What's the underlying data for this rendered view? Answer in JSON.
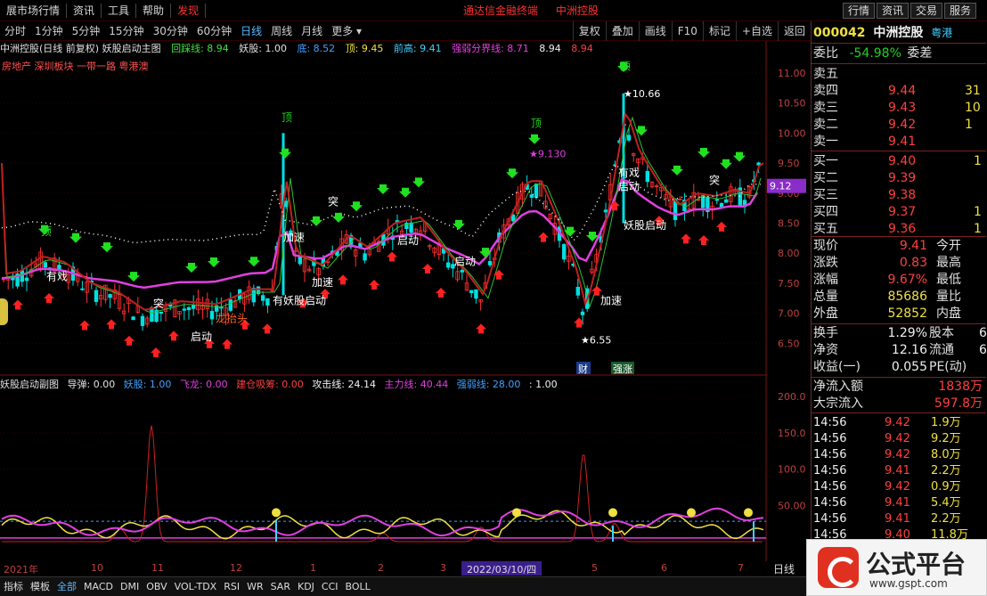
{
  "menu": {
    "items": [
      "展市场行情",
      "资讯",
      "工具",
      "帮助",
      "发现"
    ],
    "center": [
      "通达信金融终端",
      "中洲控股"
    ],
    "right_buttons": [
      "行情",
      "资讯",
      "交易",
      "服务"
    ]
  },
  "toolbar": {
    "periods": [
      "分时",
      "1分钟",
      "5分钟",
      "15分钟",
      "30分钟",
      "60分钟",
      "日线",
      "周线",
      "月线",
      "更多"
    ],
    "active_period": "日线",
    "right": [
      "复权",
      "叠加",
      "画线",
      "F10",
      "标记",
      "+自选",
      "返回"
    ]
  },
  "main_indicator": {
    "title": "中洲控股(日线 前复权) 妖股启动主图",
    "hui_cai": "回踩线: 8.94",
    "yao_gu": "妖股: 1.00",
    "di": "底: 8.52",
    "ding": "顶: 9.45",
    "qian_gao": "前高: 9.41",
    "strength": "强弱分界线: 8.71",
    "v1": "8.94",
    "v2": "8.94",
    "sector": "房地产 深圳板块 一带一路 粤港澳"
  },
  "sub_indicator": {
    "title": "妖股启动副图",
    "dao_dan": "导弹: 0.00",
    "yao_gu": "妖股: 1.00",
    "fei_long": "飞龙: 0.00",
    "jian_cang": "建仓吸筹: 0.00",
    "gong_ji": "攻击线: 24.14",
    "zhu_li": "主力线: 40.44",
    "qiang_ruo": "强弱线: 28.00",
    "last": ": 1.00"
  },
  "price_axis": [
    "11.00",
    "10.50",
    "10.00",
    "9.50",
    "9.00",
    "8.50",
    "8.00",
    "7.50",
    "7.00",
    "6.50"
  ],
  "current_price_tag": "9.12",
  "sub_axis": [
    "200.0",
    "150.0",
    "100.0",
    "50.00"
  ],
  "annotations": {
    "high": "10.66",
    "low": "6.55",
    "p2": "9.130",
    "words": [
      "顶",
      "有戏",
      "启动",
      "加速",
      "突",
      "财",
      "强涨",
      "有妖股启动",
      "龙抬头",
      "妖股启动"
    ]
  },
  "time_axis": [
    "2021年",
    "10",
    "11",
    "12",
    "1",
    "2",
    "3",
    "4",
    "5",
    "6",
    "7"
  ],
  "date_box": "2022/03/10/四",
  "period_label": "日线",
  "bottom_tabs": [
    "指标",
    "模板",
    "全部",
    "MACD",
    "DMI",
    "OBV",
    "VOL-TDX",
    "RSI",
    "WR",
    "SAR",
    "KDJ",
    "CCI",
    "BOLL"
  ],
  "active_bottom_tab": "全部",
  "quote": {
    "code": "000042",
    "name": "中洲控股",
    "region": "粤港",
    "wei_bi_label": "委比",
    "wei_bi": "-54.98%",
    "wei_cha_label": "委差",
    "sell": [
      {
        "label": "卖五",
        "price": "",
        "vol": ""
      },
      {
        "label": "卖四",
        "price": "9.44",
        "vol": "31"
      },
      {
        "label": "卖三",
        "price": "9.43",
        "vol": "10"
      },
      {
        "label": "卖二",
        "price": "9.42",
        "vol": "1"
      },
      {
        "label": "卖一",
        "price": "9.41",
        "vol": ""
      }
    ],
    "buy": [
      {
        "label": "买一",
        "price": "9.40",
        "vol": "1"
      },
      {
        "label": "买二",
        "price": "9.39",
        "vol": ""
      },
      {
        "label": "买三",
        "price": "9.38",
        "vol": ""
      },
      {
        "label": "买四",
        "price": "9.37",
        "vol": "1"
      },
      {
        "label": "买五",
        "price": "9.36",
        "vol": "1"
      }
    ],
    "stats": [
      {
        "l1": "现价",
        "v1": "9.41",
        "l2": "今开"
      },
      {
        "l1": "涨跌",
        "v1": "0.83",
        "l2": "最高"
      },
      {
        "l1": "涨幅",
        "v1": "9.67%",
        "l2": "最低"
      },
      {
        "l1": "总量",
        "v1": "85686",
        "l2": "量比"
      },
      {
        "l1": "外盘",
        "v1": "52852",
        "l2": "内盘"
      }
    ],
    "stats2": [
      {
        "l1": "换手",
        "v1": "1.29%",
        "l2": "股本",
        "v2": "6"
      },
      {
        "l1": "净资",
        "v1": "12.16",
        "l2": "流通",
        "v2": "6"
      },
      {
        "l1": "收益(一)",
        "v1": "0.055",
        "l2": "PE(动)",
        "v2": ""
      }
    ],
    "flow": [
      {
        "label": "净流入额",
        "value": "1838万"
      },
      {
        "label": "大宗流入",
        "value": "597.8万"
      }
    ],
    "trades": [
      {
        "time": "14:56",
        "price": "9.42",
        "vol": "1.9万"
      },
      {
        "time": "14:56",
        "price": "9.42",
        "vol": "9.2万"
      },
      {
        "time": "14:56",
        "price": "9.42",
        "vol": "8.0万"
      },
      {
        "time": "14:56",
        "price": "9.41",
        "vol": "2.2万"
      },
      {
        "time": "14:56",
        "price": "9.42",
        "vol": "0.9万"
      },
      {
        "time": "14:56",
        "price": "9.41",
        "vol": "5.4万"
      },
      {
        "time": "14:56",
        "price": "9.41",
        "vol": "2.2万"
      },
      {
        "time": "14:56",
        "price": "9.40",
        "vol": "11.8万"
      }
    ]
  },
  "logo": {
    "text": "公式平台",
    "url": "www.gspt.com"
  },
  "colors": {
    "up": "#ff3030",
    "down": "#00e0e0",
    "ma": "#e040e0",
    "dots": "#ffffff",
    "yellow": "#f0e040"
  }
}
